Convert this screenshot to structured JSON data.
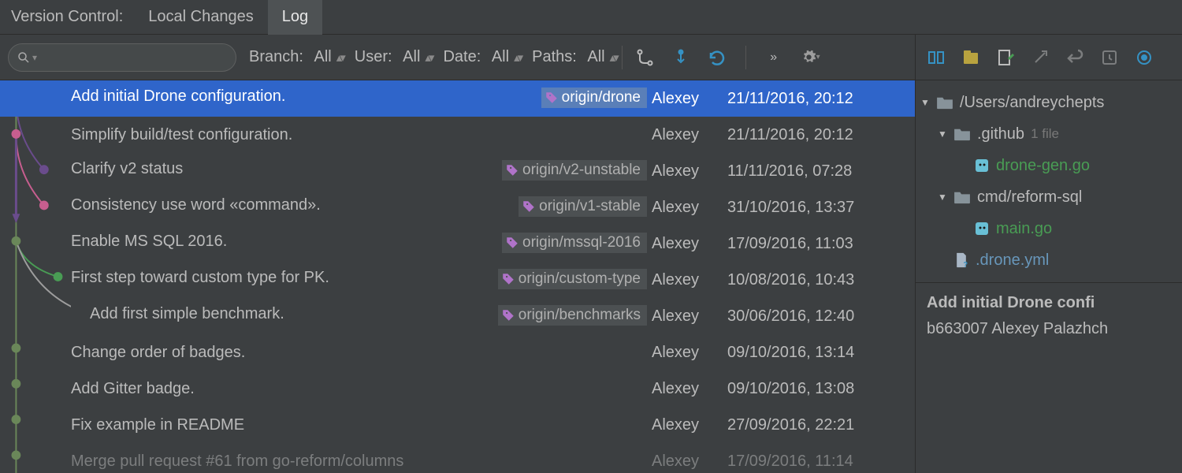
{
  "header": {
    "vc_label": "Version Control:",
    "tab_local": "Local Changes",
    "tab_log": "Log"
  },
  "filters": {
    "branch_label": "Branch:",
    "branch_value": "All",
    "user_label": "User:",
    "user_value": "All",
    "date_label": "Date:",
    "date_value": "All",
    "paths_label": "Paths:",
    "paths_value": "All"
  },
  "commits": [
    {
      "msg": "Add initial Drone configuration.",
      "branch": "origin/drone",
      "author": "Alexey",
      "date": "21/11/2016, 20:12",
      "selected": true,
      "indent": 0,
      "dot": "#ffffff",
      "dotx": 20
    },
    {
      "msg": "Simplify build/test configuration.",
      "branch": "",
      "author": "Alexey",
      "date": "21/11/2016, 20:12",
      "indent": 0,
      "dot": "#c75e8f",
      "dotx": 20
    },
    {
      "msg": "Clarify v2 status",
      "branch": "origin/v2-unstable",
      "author": "Alexey",
      "date": "11/11/2016, 07:28",
      "indent": 0,
      "dot": "#6a4c8c",
      "dotx": 56
    },
    {
      "msg": "Consistency use word «command».",
      "branch": "origin/v1-stable",
      "author": "Alexey",
      "date": "31/10/2016, 13:37",
      "indent": 0,
      "dot": "#c75e8f",
      "dotx": 56
    },
    {
      "msg": "Enable MS SQL 2016.",
      "branch": "origin/mssql-2016",
      "author": "Alexey",
      "date": "17/09/2016, 11:03",
      "indent": 0,
      "dot": "#6a8759",
      "dotx": 20
    },
    {
      "msg": "First step toward custom type for PK.",
      "branch": "origin/custom-type",
      "author": "Alexey",
      "date": "10/08/2016, 10:43",
      "indent": 0,
      "dot": "#499c54",
      "dotx": 74
    },
    {
      "msg": "Add first simple benchmark.",
      "branch": "origin/benchmarks",
      "author": "Alexey",
      "date": "30/06/2016, 12:40",
      "indent": 24,
      "dot": "#9e9e9e",
      "dotx": 108
    },
    {
      "msg": "Change order of badges.",
      "branch": "",
      "author": "Alexey",
      "date": "09/10/2016, 13:14",
      "indent": 0,
      "dot": "#6a8759",
      "dotx": 20
    },
    {
      "msg": "Add Gitter badge.",
      "branch": "",
      "author": "Alexey",
      "date": "09/10/2016, 13:08",
      "indent": 0,
      "dot": "#6a8759",
      "dotx": 20
    },
    {
      "msg": "Fix example in README",
      "branch": "",
      "author": "Alexey",
      "date": "27/09/2016, 22:21",
      "indent": 0,
      "dot": "#6a8759",
      "dotx": 20
    },
    {
      "msg": "Merge pull request #61 from go-reform/columns",
      "branch": "",
      "author": "Alexey",
      "date": "17/09/2016, 11:14",
      "indent": 0,
      "dot": "#6a8759",
      "dotx": 20,
      "faded": true
    }
  ],
  "tree": {
    "root": "/Users/andreychepts",
    "github": ".github",
    "github_count": "1 file",
    "drone_gen": "drone-gen.go",
    "cmd": "cmd/reform-sql",
    "main_go": "main.go",
    "drone_yml": ".drone.yml"
  },
  "details": {
    "title": "Add initial Drone confi",
    "hash_line": "b663007 Alexey Palazhch"
  }
}
